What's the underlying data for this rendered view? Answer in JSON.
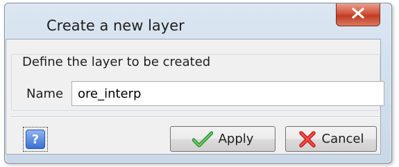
{
  "window": {
    "title": "Create a new layer",
    "close_icon": "close-x-icon"
  },
  "group": {
    "label": "Define the layer to be created"
  },
  "name_field": {
    "label": "Name",
    "value": "ore_interp"
  },
  "buttons": {
    "help_icon": "help-question-icon",
    "help_glyph": "?",
    "apply": {
      "label": "Apply",
      "icon": "green-check-icon"
    },
    "cancel": {
      "label": "Cancel",
      "icon": "red-x-icon"
    }
  },
  "colors": {
    "close_button": "#c8452b",
    "check_green": "#3aa53a",
    "cancel_red": "#e0302c",
    "help_blue": "#3b6fd6"
  }
}
